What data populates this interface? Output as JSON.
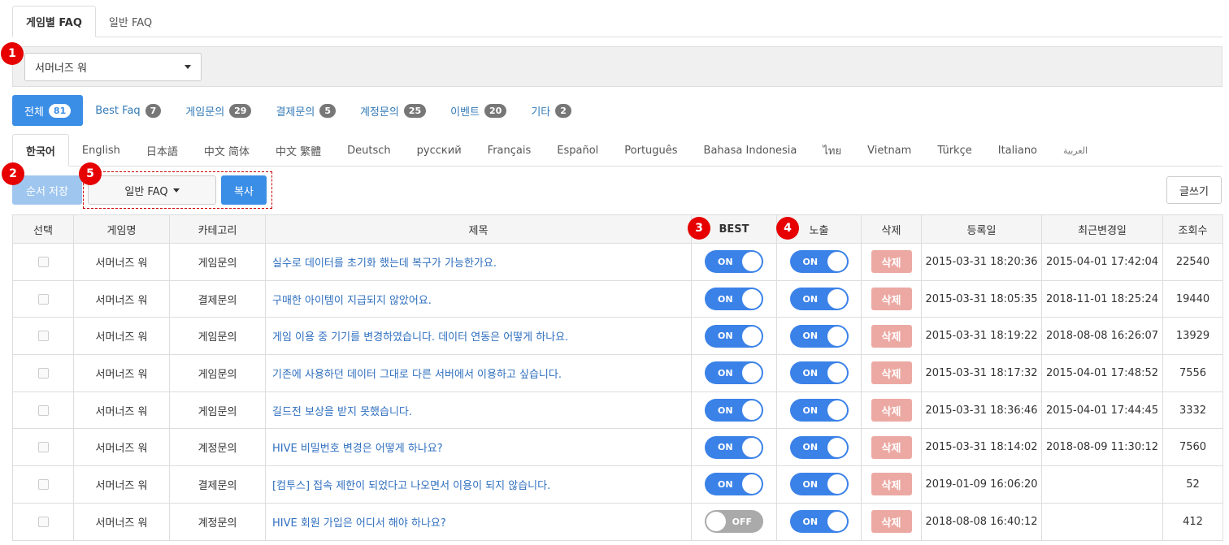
{
  "top_tabs": [
    "게임별 FAQ",
    "일반 FAQ"
  ],
  "game_select": {
    "value": "서머너즈 워"
  },
  "categories": [
    {
      "label": "전체",
      "count": "81"
    },
    {
      "label": "Best Faq",
      "count": "7"
    },
    {
      "label": "게임문의",
      "count": "29"
    },
    {
      "label": "결제문의",
      "count": "5"
    },
    {
      "label": "계정문의",
      "count": "25"
    },
    {
      "label": "이벤트",
      "count": "20"
    },
    {
      "label": "기타",
      "count": "2"
    }
  ],
  "languages": [
    "한국어",
    "English",
    "日本語",
    "中文 简体",
    "中文 繁體",
    "Deutsch",
    "русский",
    "Français",
    "Español",
    "Português",
    "Bahasa Indonesia",
    "ไทย",
    "Vietnam",
    "Türkçe",
    "Italiano",
    "العربية"
  ],
  "toolbar": {
    "order_save": "순서 저장",
    "faq_dropdown": "일반 FAQ",
    "copy": "복사",
    "write": "글쓰기"
  },
  "markers": [
    "1",
    "2",
    "3",
    "4",
    "5"
  ],
  "table": {
    "headers": [
      "선택",
      "게임명",
      "카테고리",
      "제목",
      "BEST",
      "노출",
      "삭제",
      "등록일",
      "최근변경일",
      "조회수"
    ],
    "on_label": "ON",
    "off_label": "OFF",
    "delete_label": "삭제",
    "rows": [
      {
        "game": "서머너즈 워",
        "category": "게임문의",
        "title": "실수로 데이터를 초기화 했는데 복구가 가능한가요.",
        "best": true,
        "visible": true,
        "created": "2015-03-31 18:20:36",
        "updated": "2015-04-01 17:42:04",
        "views": "22540"
      },
      {
        "game": "서머너즈 워",
        "category": "결제문의",
        "title": "구매한 아이템이 지급되지 않았어요.",
        "best": true,
        "visible": true,
        "created": "2015-03-31 18:05:35",
        "updated": "2018-11-01 18:25:24",
        "views": "19440"
      },
      {
        "game": "서머너즈 워",
        "category": "게임문의",
        "title": "게임 이용 중 기기를 변경하였습니다. 데이터 연동은 어떻게 하나요.",
        "best": true,
        "visible": true,
        "created": "2015-03-31 18:19:22",
        "updated": "2018-08-08 16:26:07",
        "views": "13929"
      },
      {
        "game": "서머너즈 워",
        "category": "게임문의",
        "title": "기존에 사용하던 데이터 그대로 다른 서버에서 이용하고 싶습니다.",
        "best": true,
        "visible": true,
        "created": "2015-03-31 18:17:32",
        "updated": "2015-04-01 17:48:52",
        "views": "7556"
      },
      {
        "game": "서머너즈 워",
        "category": "게임문의",
        "title": "길드전 보상을 받지 못했습니다.",
        "best": true,
        "visible": true,
        "created": "2015-03-31 18:36:46",
        "updated": "2015-04-01 17:44:45",
        "views": "3332"
      },
      {
        "game": "서머너즈 워",
        "category": "계정문의",
        "title": "HIVE 비밀번호 변경은 어떻게 하나요?",
        "best": true,
        "visible": true,
        "created": "2015-03-31 18:14:02",
        "updated": "2018-08-09 11:30:12",
        "views": "7560"
      },
      {
        "game": "서머너즈 워",
        "category": "결제문의",
        "title": "[컴투스] 접속 제한이 되었다고 나오면서 이용이 되지 않습니다.",
        "best": true,
        "visible": true,
        "created": "2019-01-09 16:06:20",
        "updated": "",
        "views": "52"
      },
      {
        "game": "서머너즈 워",
        "category": "계정문의",
        "title": "HIVE 회원 가입은 어디서 해야 하나요?",
        "best": false,
        "visible": true,
        "created": "2018-08-08 16:40:12",
        "updated": "",
        "views": "412"
      }
    ]
  },
  "colors": {
    "primary": "#3b8ee6",
    "toggle_on": "#3b82e8",
    "delete": "#eca9a3",
    "marker": "#e60000",
    "link": "#2f6fbf"
  }
}
